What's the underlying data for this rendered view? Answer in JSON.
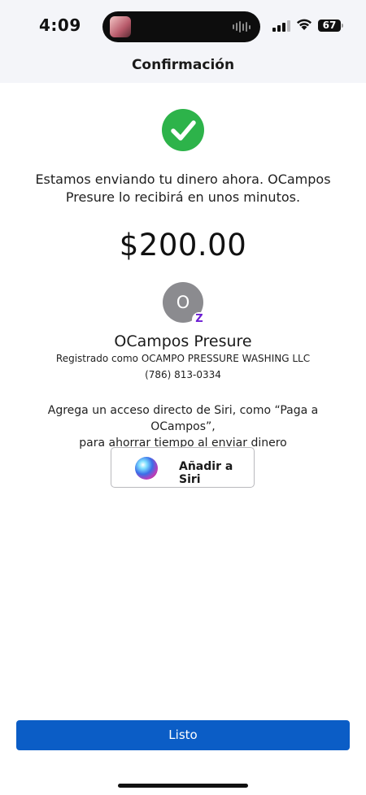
{
  "status_bar": {
    "time": "4:09",
    "battery": "67"
  },
  "header": {
    "title": "Confirmación"
  },
  "confirmation": {
    "message": "Estamos enviando tu dinero ahora. OCampos\nPresure  lo recibirá en unos minutos.",
    "amount": "$200.00"
  },
  "recipient": {
    "initial": "O",
    "badge": "Z",
    "name": "OCampos Presure",
    "registered_as": "Registrado como OCAMPO PRESSURE WASHING LLC",
    "phone": "(786) 813-0334"
  },
  "siri": {
    "prompt": "Agrega un acceso directo de Siri, como “Paga a OCampos”,\npara ahorrar tiempo al enviar dinero",
    "button_label": "Añadir a Siri"
  },
  "footer": {
    "done_label": "Listo"
  },
  "colors": {
    "success": "#2db34a",
    "primary": "#0b5dc6",
    "zelle": "#6d1ed4",
    "avatar": "#8b8b8f"
  }
}
